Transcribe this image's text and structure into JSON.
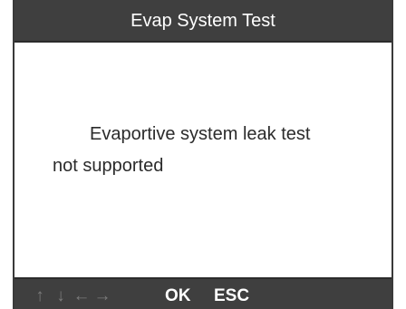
{
  "window": {
    "title": "Evap System Test"
  },
  "message": {
    "line1": "Evaportive system leak test",
    "line2": "not supported"
  },
  "footer": {
    "arrows": [
      "↑",
      "↓",
      "←",
      "→"
    ],
    "ok_label": "OK",
    "esc_label": "ESC"
  }
}
